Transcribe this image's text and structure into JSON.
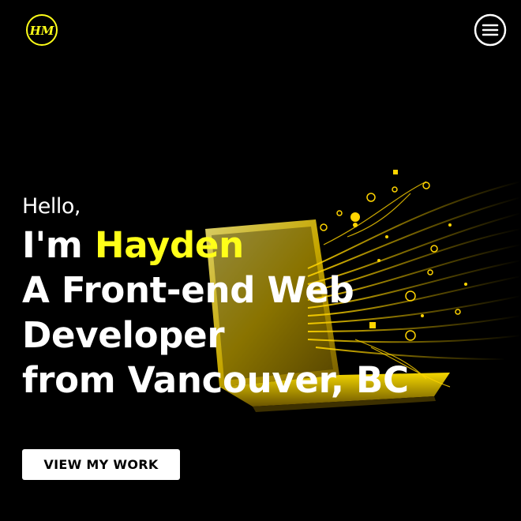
{
  "header": {
    "logo_text": "HM",
    "menu_icon": "hamburger-menu-icon"
  },
  "hero": {
    "greeting": "Hello,",
    "intro_prefix": "I'm ",
    "name": "Hayden",
    "role_line": "A Front-end Web",
    "role_line_2": "Developer",
    "location_line": "from Vancouver, BC",
    "image": "laptop-with-data-streams-illustration"
  },
  "cta": {
    "label": "VIEW MY WORK"
  },
  "colors": {
    "background": "#000000",
    "accent": "#ffff19",
    "text": "#ffffff",
    "button_bg": "#ffffff",
    "button_text": "#000000"
  }
}
